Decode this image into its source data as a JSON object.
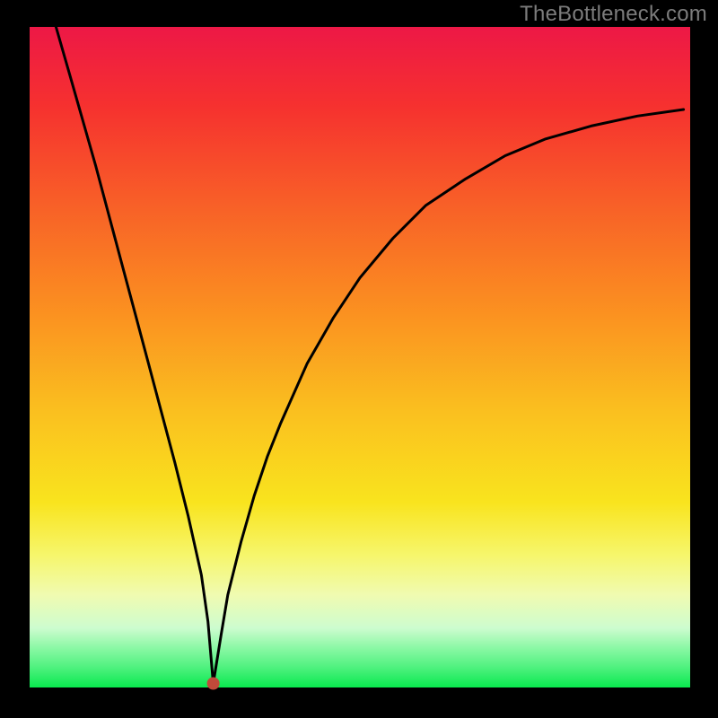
{
  "watermark": "TheBottleneck.com",
  "chart_data": {
    "type": "line",
    "title": "",
    "xlabel": "",
    "ylabel": "",
    "xlim": [
      0,
      100
    ],
    "ylim": [
      0,
      100
    ],
    "series": [
      {
        "name": "bottleneck-curve",
        "x": [
          4,
          6,
          8,
          10,
          12,
          14,
          16,
          18,
          20,
          22,
          24,
          26,
          27,
          27.8,
          29,
          30,
          32,
          34,
          36,
          38,
          42,
          46,
          50,
          55,
          60,
          66,
          72,
          78,
          85,
          92,
          99
        ],
        "values": [
          100,
          93,
          86,
          79,
          71.5,
          64,
          56.5,
          49,
          41.5,
          34,
          26,
          17,
          10,
          0.6,
          8,
          14,
          22,
          29,
          35,
          40,
          49,
          56,
          62,
          68,
          73,
          77,
          80.5,
          83,
          85,
          86.5,
          87.5
        ]
      }
    ],
    "annotations": [
      {
        "name": "minimum-point",
        "x": 27.8,
        "y": 0.6
      }
    ],
    "background_gradient": {
      "direction": "vertical",
      "stops": [
        {
          "pos": 0,
          "color": "#ed1846"
        },
        {
          "pos": 28,
          "color": "#f86327"
        },
        {
          "pos": 58,
          "color": "#fabf1f"
        },
        {
          "pos": 80,
          "color": "#f6f66c"
        },
        {
          "pos": 100,
          "color": "#09e94f"
        }
      ]
    }
  }
}
